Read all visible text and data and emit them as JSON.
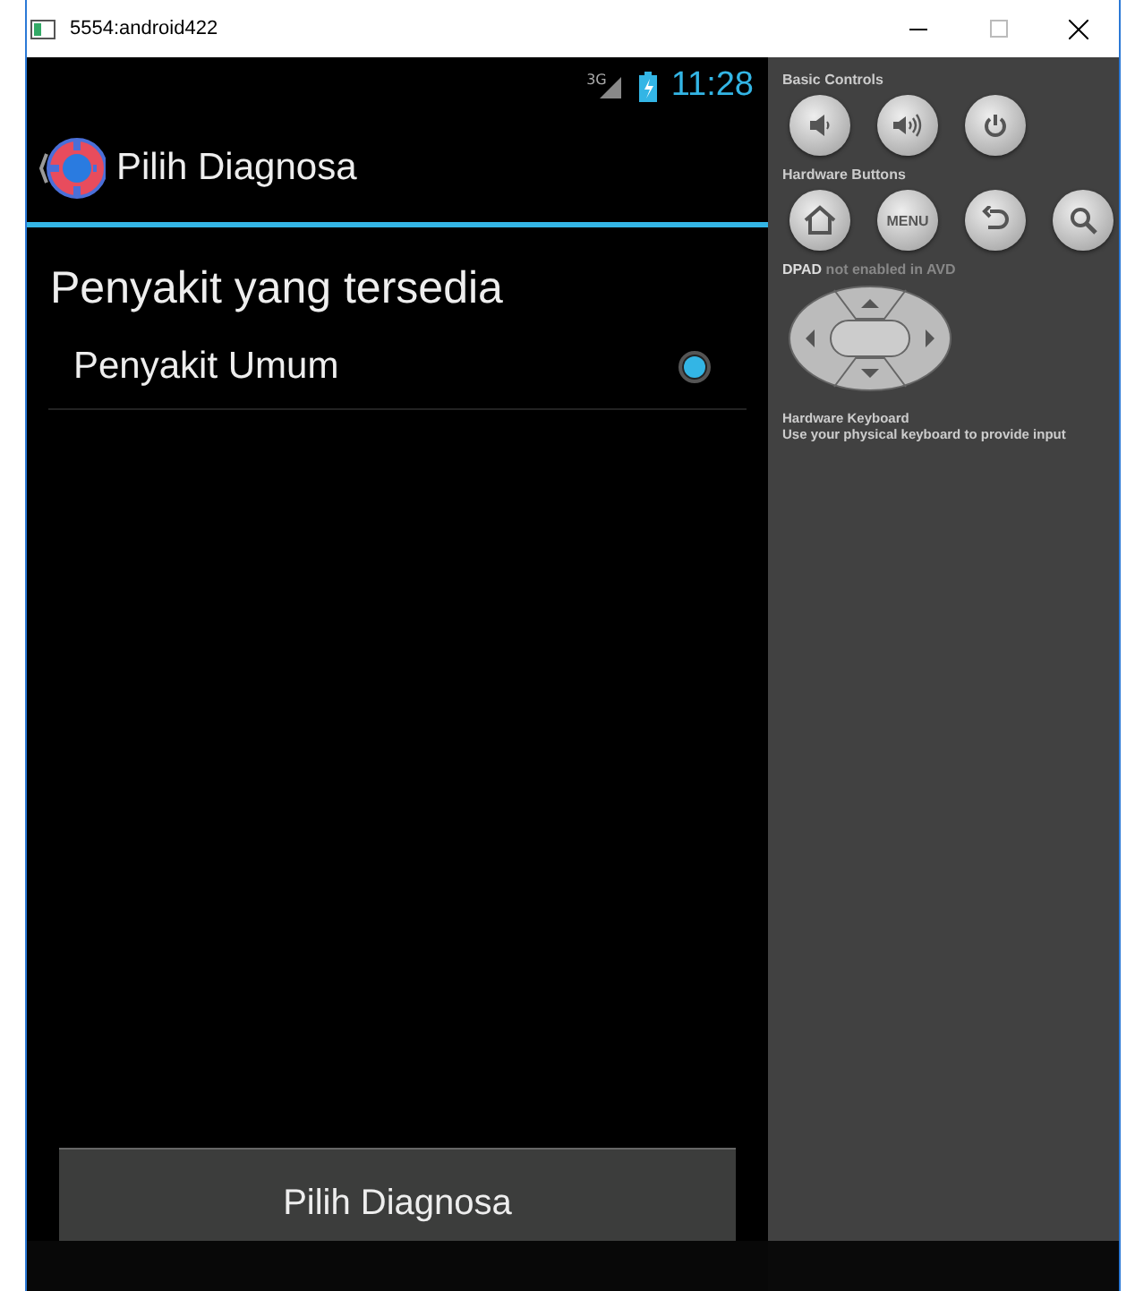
{
  "window": {
    "title": "5554:android422"
  },
  "status_bar": {
    "network": "3G",
    "time": "11:28"
  },
  "action_bar": {
    "title": "Pilih Diagnosa"
  },
  "heading": "Penyakit yang tersedia",
  "options": [
    {
      "label": "Penyakit Umum",
      "selected": true
    }
  ],
  "button": "Pilih Diagnosa",
  "controls_panel": {
    "basic_title": "Basic Controls",
    "basic_controls": [
      {
        "kind": "volume-down"
      },
      {
        "kind": "volume-up"
      },
      {
        "kind": "power"
      }
    ],
    "hardware_title": "Hardware Buttons",
    "hardware_buttons": [
      {
        "kind": "home"
      },
      {
        "kind": "menu",
        "label": "MENU"
      },
      {
        "kind": "back"
      },
      {
        "kind": "search"
      }
    ],
    "dpad_title": "**DPAD** not enabled in AVD",
    "keyboard_title": "Hardware Keyboard",
    "keyboard_hint": "Use your physical keyboard to provide input"
  }
}
